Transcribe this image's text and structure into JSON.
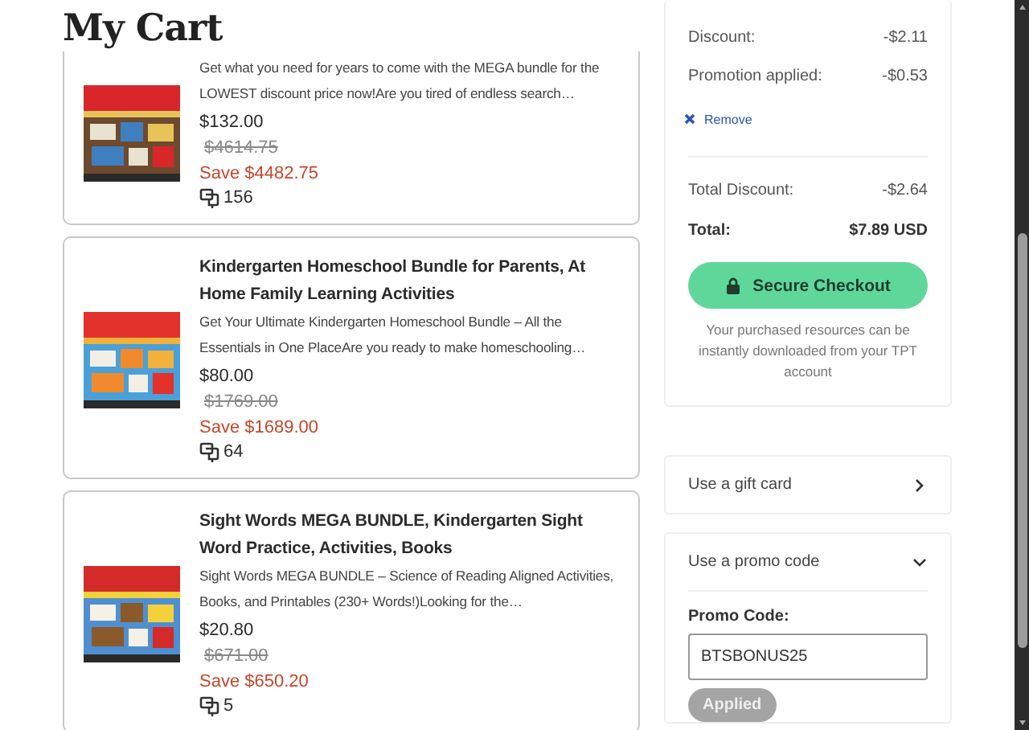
{
  "page": {
    "title": "My Cart"
  },
  "items": [
    {
      "description": "Get what you need for years to come with the MEGA bundle for the LOWEST discount price now!Are you tired of endless search…",
      "price": "$132.00",
      "original_price": "$4614.75",
      "savings": "Save $4482.75",
      "count": "156"
    },
    {
      "title": "Kindergarten Homeschool Bundle for Parents, At Home Family Learning Activities",
      "description": "Get Your Ultimate Kindergarten Homeschool Bundle – All the Essentials in One PlaceAre you ready to make homeschooling…",
      "price": "$80.00",
      "original_price": "$1769.00",
      "savings": "Save $1689.00",
      "count": "64"
    },
    {
      "title": "Sight Words MEGA BUNDLE, Kindergarten Sight Word Practice, Activities, Books",
      "description": "Sight Words MEGA BUNDLE – Science of Reading Aligned Activities, Books, and Printables (230+ Words!)Looking for the…",
      "price": "$20.80",
      "original_price": "$671.00",
      "savings": "Save $650.20",
      "count": "5"
    }
  ],
  "summary": {
    "rows": [
      {
        "label": "Discount:",
        "value": "-$2.11"
      },
      {
        "label": "Promotion applied:",
        "value": "-$0.53"
      }
    ],
    "remove": "Remove",
    "total_discount": {
      "label": "Total Discount:",
      "value": "-$2.64"
    },
    "total": {
      "label": "Total:",
      "value": "$7.89 USD"
    },
    "checkout": "Secure Checkout",
    "note": "Your purchased resources can be instantly downloaded from your TPT account"
  },
  "gift_card": {
    "label": "Use a gift card",
    "expanded": false
  },
  "promo": {
    "label": "Use a promo code",
    "expanded": true,
    "field_label": "Promo Code:",
    "value": "BTSBONUS25",
    "button": "Applied",
    "disabled": true
  }
}
